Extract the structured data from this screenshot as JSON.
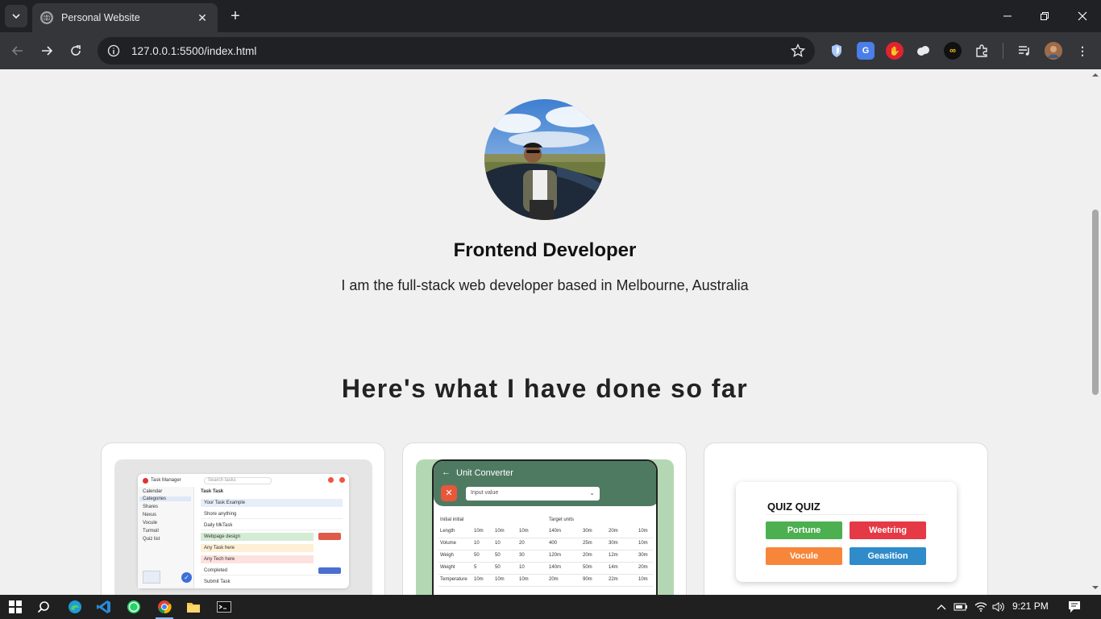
{
  "browser": {
    "tab_title": "Personal Website",
    "url": "127.0.0.1:5500/index.html",
    "new_tab_symbol": "+",
    "close_symbol": "✕"
  },
  "hero": {
    "title": "Frontend Developer",
    "subtitle": "I am the full-stack web developer based in Melbourne, Australia"
  },
  "projects_section": {
    "heading": "Here's what I have done so far"
  },
  "project_cards": [
    {
      "kind": "task-manager",
      "app_name": "Task Manager",
      "search_placeholder": "Search tasks",
      "list_header": "Task Task",
      "sidebar": [
        "Calendar",
        "Categories",
        "Shares",
        "Nexus",
        "Vocule",
        "Turmoil",
        "Quiz list"
      ],
      "tasks": [
        "Your Task Example",
        "Shore anything",
        "Daily MkTask",
        "Webpage design",
        "Any Task here",
        "Any Tech here",
        "Completed",
        "Submit Task"
      ]
    },
    {
      "kind": "unit-converter",
      "app_title": "Unit Converter",
      "input_placeholder": "Input value",
      "col_initial": "Initial initial",
      "col_target": "Target units",
      "rows": [
        {
          "label": "Length",
          "a": "10m",
          "b": "10m",
          "c": "10m",
          "d": "140m",
          "e": "30m",
          "f": "20m",
          "g": "10m"
        },
        {
          "label": "Volume",
          "a": "10",
          "b": "10",
          "c": "20",
          "d": "400",
          "e": "25m",
          "f": "30m",
          "g": "10m"
        },
        {
          "label": "Weigh",
          "a": "50",
          "b": "50",
          "c": "30",
          "d": "120m",
          "e": "20m",
          "f": "12m",
          "g": "30m"
        },
        {
          "label": "Weight",
          "a": "5",
          "b": "50",
          "c": "10",
          "d": "140m",
          "e": "50m",
          "f": "14m",
          "g": "20m"
        },
        {
          "label": "Temperature",
          "a": "10m",
          "b": "10m",
          "c": "10m",
          "d": "20m",
          "e": "90m",
          "f": "22m",
          "g": "10m"
        }
      ]
    },
    {
      "kind": "quiz",
      "quiz_title": "QUIZ QUIZ",
      "answers": [
        {
          "label": "Portune",
          "color": "#4caf50"
        },
        {
          "label": "Weetring",
          "color": "#e53945"
        },
        {
          "label": "Vocule",
          "color": "#f7863a"
        },
        {
          "label": "Geasition",
          "color": "#2f8bc9"
        }
      ]
    }
  ],
  "taskbar": {
    "time": "9:21 PM"
  },
  "colors": {
    "page_bg": "#f0f0f0",
    "chrome_dark": "#202124",
    "chrome_toolbar": "#35363a",
    "converter_green": "#4f7a62"
  }
}
